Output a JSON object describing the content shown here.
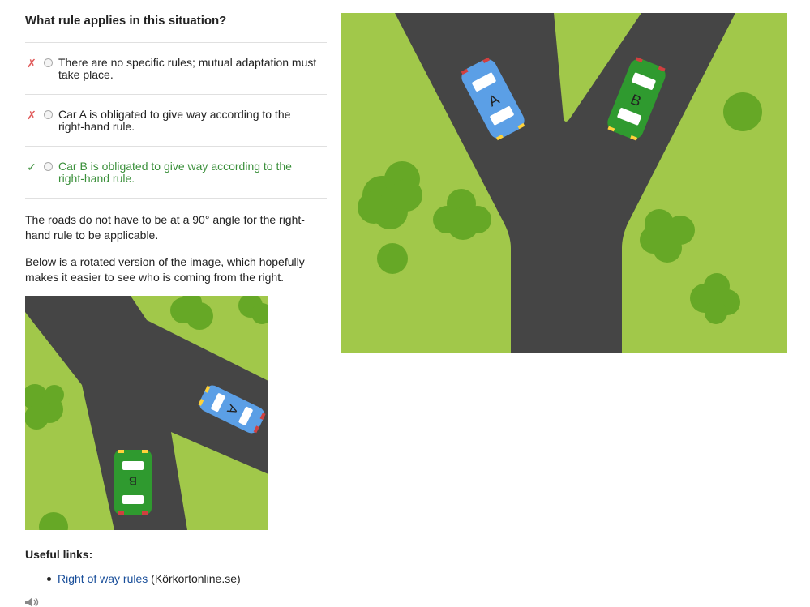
{
  "question": "What rule applies in this situation?",
  "options": [
    {
      "text": "There are no specific rules; mutual adaptation must take place.",
      "status": "wrong",
      "mark": "✗"
    },
    {
      "text": "Car A is obligated to give way according to the right-hand rule.",
      "status": "wrong",
      "mark": "✗"
    },
    {
      "text": "Car B is obligated to give way according to the right-hand rule.",
      "status": "correct",
      "mark": "✓"
    }
  ],
  "explanation": [
    "The roads do not have to be at a 90° angle for the right-hand rule to be applicable.",
    "Below is a rotated version of the image, which hopefully makes it easier to see who is coming from the right."
  ],
  "cars": {
    "a": "A",
    "b": "B"
  },
  "links": {
    "title": "Useful links:",
    "items": [
      {
        "label": "Right of way rules",
        "source": "(Körkortonline.se)"
      }
    ]
  },
  "colors": {
    "grass": "#a1c84a",
    "road": "#454545",
    "bush": "#66a826",
    "car_a": "#5b9fe6",
    "car_b": "#2f9a2f",
    "link": "#1a4f9a",
    "correct": "#3a8f3a",
    "wrong": "#e05a5a"
  }
}
